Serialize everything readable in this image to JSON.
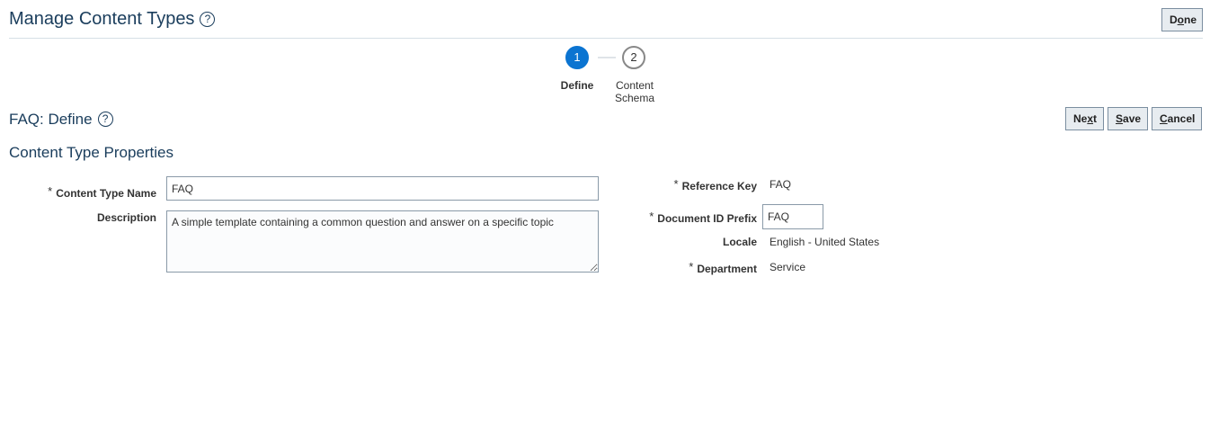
{
  "page": {
    "title": "Manage Content Types",
    "help": "?",
    "done": [
      "D",
      "o",
      "ne"
    ]
  },
  "train": {
    "steps": [
      {
        "number": "1",
        "label": "Define"
      },
      {
        "number": "2",
        "label_line1": "Content",
        "label_line2": "Schema"
      }
    ]
  },
  "section": {
    "title": "FAQ: Define",
    "help": "?",
    "next": [
      "Ne",
      "x",
      "t"
    ],
    "save": [
      "",
      "S",
      "ave"
    ],
    "cancel": [
      "",
      "C",
      "ancel"
    ]
  },
  "properties": {
    "title": "Content Type Properties",
    "content_type_name": {
      "label": "Content Type Name",
      "value": "FAQ",
      "required": "*"
    },
    "description": {
      "label": "Description",
      "value": "A simple template containing a common question and answer on a specific topic"
    },
    "reference_key": {
      "label": "Reference Key",
      "value": "FAQ",
      "required": "*"
    },
    "document_id_prefix": {
      "label": "Document ID Prefix",
      "value": "FAQ",
      "required": "*"
    },
    "locale": {
      "label": "Locale",
      "value": "English - United States"
    },
    "department": {
      "label": "Department",
      "value": "Service",
      "required": "*"
    }
  }
}
